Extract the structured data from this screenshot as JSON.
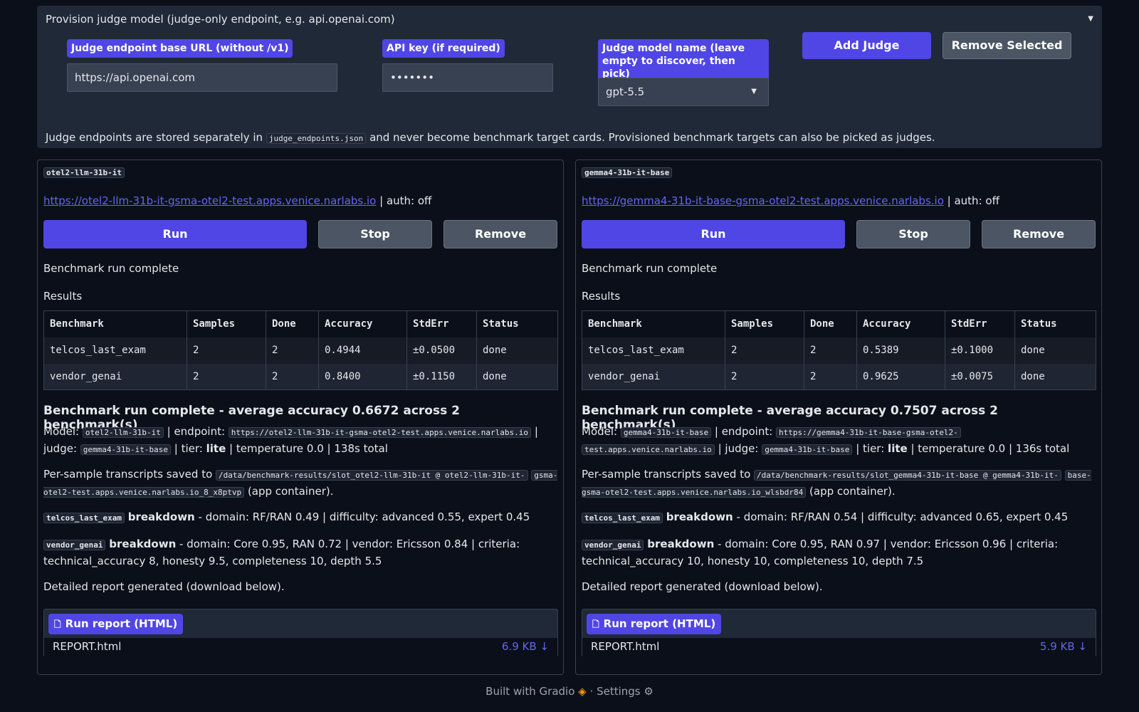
{
  "provision": {
    "title": "Provision judge model (judge-only endpoint, e.g. api.openai.com)",
    "endpoint_label": "Judge endpoint base URL (without /v1)",
    "endpoint_value": "https://api.openai.com",
    "api_key_label": "API key (if required)",
    "api_key_value": "•••••••",
    "model_label_line1": "Judge model name (leave",
    "model_label_line2": "empty to discover, then pick)",
    "model_value": "gpt-5.5",
    "add_judge": "Add Judge",
    "remove_selected": "Remove Selected",
    "note_before": "Judge endpoints are stored separately in",
    "note_code": "judge_endpoints.json",
    "note_after": "and never become benchmark target cards. Provisioned benchmark targets can also be picked as judges."
  },
  "table_headers": [
    "Benchmark",
    "Samples",
    "Done",
    "Accuracy",
    "StdErr",
    "Status"
  ],
  "cards": [
    {
      "name": "otel2-llm-31b-it",
      "url": "https://otel2-llm-31b-it-gsma-otel2-test.apps.venice.narlabs.io",
      "auth": "| auth: off",
      "run": "Run",
      "stop": "Stop",
      "remove": "Remove",
      "status": "Benchmark run complete",
      "results_label": "Results",
      "rows": [
        [
          "telcos_last_exam",
          "2",
          "2",
          "0.4944",
          "±0.0500",
          "done"
        ],
        [
          "vendor_genai",
          "2",
          "2",
          "0.8400",
          "±0.1150",
          "done"
        ]
      ],
      "summary": "Benchmark run complete - average accuracy 0.6672 across 2 benchmark(s)",
      "model_prefix": "Model:",
      "model_code": "otel2-llm-31b-it",
      "endpoint_text": "| endpoint:",
      "endpoint_code_1": "https://otel2-llm-31b-it-gsma-otel2-test.apps.venice.narlabs.io",
      "endpoint_code_2": "",
      "judge_text": "| judge:",
      "judge_code": "gemma4-31b-it-base",
      "tier_text": "| tier:",
      "tier": "lite",
      "tail": "| temperature 0.0 | 138s total",
      "transcripts_text": "Per-sample transcripts saved to",
      "transcripts_code_1": "/data/benchmark-results/slot_otel2-llm-31b-it @ otel2-llm-31b-it-",
      "transcripts_code_2": "gsma-otel2-test.apps.venice.narlabs.io_8_x8ptvp",
      "transcripts_tail": "(app container).",
      "b1_code": "telcos_last_exam",
      "b1_word": "breakdown",
      "b1_text": "- domain: RF/RAN 0.49 | difficulty: advanced 0.55, expert 0.45",
      "b2_code": "vendor_genai",
      "b2_word": "breakdown",
      "b2_text_1": "- domain: Core 0.95, RAN 0.72 | vendor: Ericsson 0.84 | criteria:",
      "b2_text_2": "technical_accuracy 8, honesty 9.5, completeness 10, depth 5.5",
      "report_note": "Detailed report generated (download below).",
      "report_label": "Run report (HTML)",
      "report_file": "REPORT.html",
      "report_size": "6.9 KB ↓"
    },
    {
      "name": "gemma4-31b-it-base",
      "url": "https://gemma4-31b-it-base-gsma-otel2-test.apps.venice.narlabs.io",
      "auth": "| auth: off",
      "run": "Run",
      "stop": "Stop",
      "remove": "Remove",
      "status": "Benchmark run complete",
      "results_label": "Results",
      "rows": [
        [
          "telcos_last_exam",
          "2",
          "2",
          "0.5389",
          "±0.1000",
          "done"
        ],
        [
          "vendor_genai",
          "2",
          "2",
          "0.9625",
          "±0.0075",
          "done"
        ]
      ],
      "summary": "Benchmark run complete - average accuracy 0.7507 across 2 benchmark(s)",
      "model_prefix": "Model:",
      "model_code": "gemma4-31b-it-base",
      "endpoint_text": "| endpoint:",
      "endpoint_code_1": "https://gemma4-31b-it-base-gsma-otel2-",
      "endpoint_code_2": "test.apps.venice.narlabs.io",
      "judge_text": "| judge:",
      "judge_code": "gemma4-31b-it-base",
      "tier_text": "| tier:",
      "tier": "lite",
      "tail": "| temperature 0.0 | 136s total",
      "transcripts_text": "Per-sample transcripts saved to",
      "transcripts_code_1": "/data/benchmark-results/slot_gemma4-31b-it-base @ gemma4-31b-it-",
      "transcripts_code_2": "base-gsma-otel2-test.apps.venice.narlabs.io_wlsbdr84",
      "transcripts_tail": "(app container).",
      "b1_code": "telcos_last_exam",
      "b1_word": "breakdown",
      "b1_text": "- domain: RF/RAN 0.54 | difficulty: advanced 0.65, expert 0.45",
      "b2_code": "vendor_genai",
      "b2_word": "breakdown",
      "b2_text_1": "- domain: Core 0.95, RAN 0.97 | vendor: Ericsson 0.96 | criteria:",
      "b2_text_2": "technical_accuracy 10, honesty 10, completeness 10, depth 7.5",
      "report_note": "Detailed report generated (download below).",
      "report_label": "Run report (HTML)",
      "report_file": "REPORT.html",
      "report_size": "5.9 KB ↓"
    }
  ],
  "footer": {
    "built_with": "Built with Gradio",
    "separator": "·",
    "settings": "Settings"
  },
  "colors": {
    "background": "#0b0f19",
    "panel": "#1f2937",
    "accent": "#4f46e5",
    "link": "#6366f1"
  }
}
